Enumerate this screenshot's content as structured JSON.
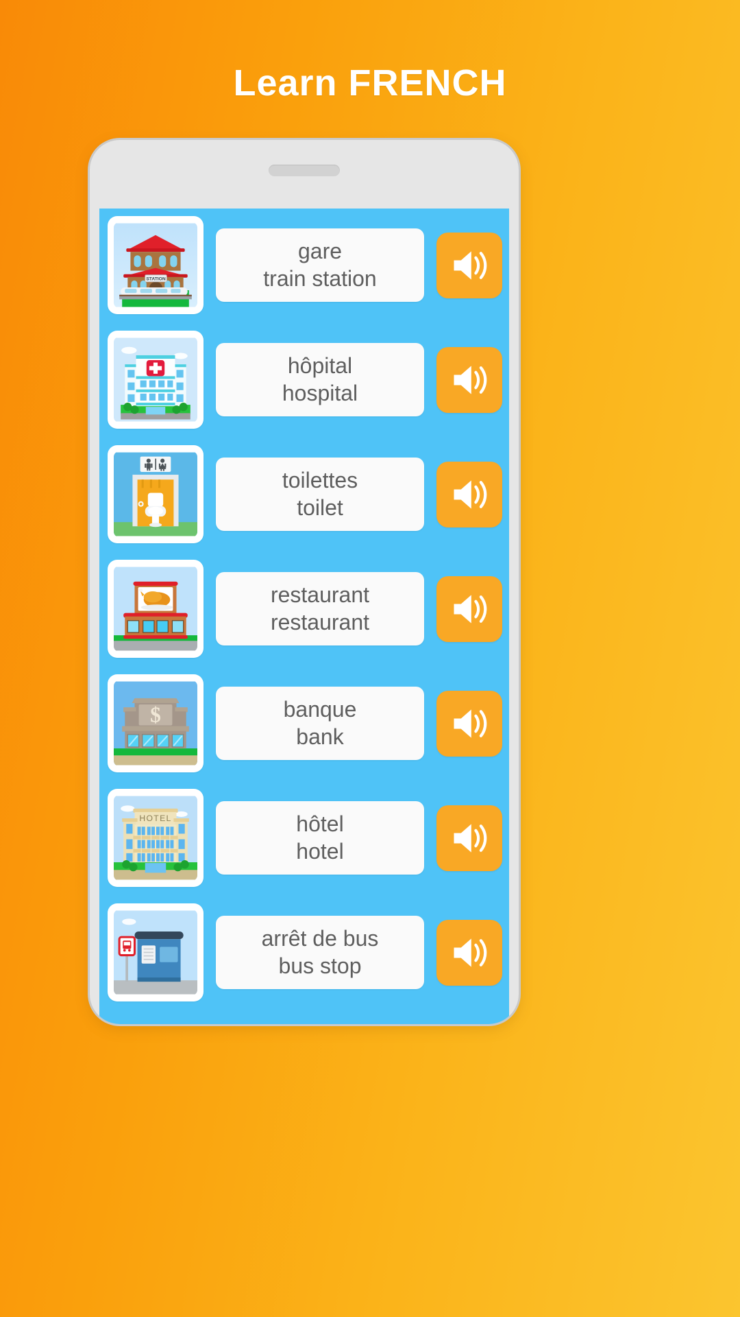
{
  "header": {
    "title": "Learn FRENCH"
  },
  "phone": {
    "speaker_grille_name": "phone-speaker-grille"
  },
  "screen": {
    "background_color": "#4FC3F7",
    "card_background_color": "#FAFAFA",
    "accent_color": "#F9A825",
    "text_color": "#5E5E5E"
  },
  "list": {
    "items": [
      {
        "french": "gare",
        "english": "train station",
        "icon": "train-station-icon",
        "speak_label": "speaker-icon"
      },
      {
        "french": "hôpital",
        "english": "hospital",
        "icon": "hospital-icon",
        "speak_label": "speaker-icon"
      },
      {
        "french": "toilettes",
        "english": "toilet",
        "icon": "toilet-icon",
        "speak_label": "speaker-icon"
      },
      {
        "french": "restaurant",
        "english": "restaurant",
        "icon": "restaurant-icon",
        "speak_label": "speaker-icon"
      },
      {
        "french": "banque",
        "english": "bank",
        "icon": "bank-icon",
        "speak_label": "speaker-icon"
      },
      {
        "french": "hôtel",
        "english": "hotel",
        "icon": "hotel-icon",
        "speak_label": "speaker-icon"
      },
      {
        "french": "arrêt de bus",
        "english": "bus stop",
        "icon": "bus-stop-icon",
        "speak_label": "speaker-icon"
      }
    ]
  },
  "icon_labels": {
    "station_sign": "STATION",
    "hotel_sign": "HOTEL",
    "bank_sign": "$"
  }
}
